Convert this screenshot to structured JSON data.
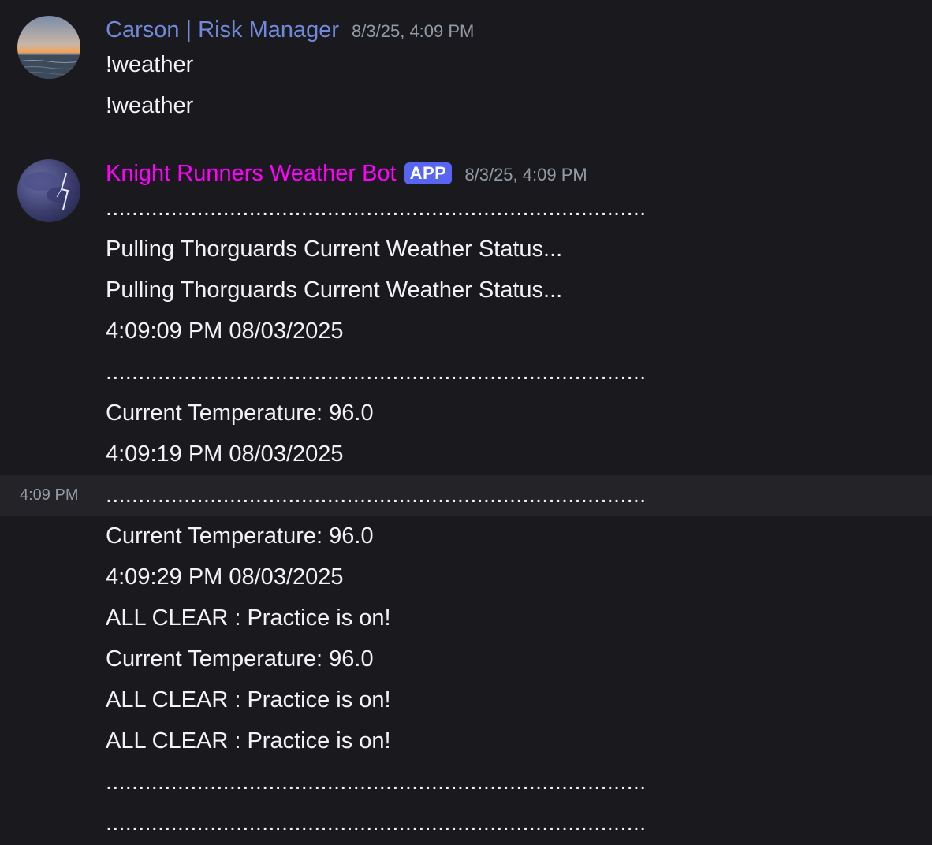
{
  "messages": [
    {
      "author": "Carson | Risk Manager",
      "author_color": "#7289da",
      "timestamp": "8/3/25, 4:09 PM",
      "lines": [
        "!weather",
        "!weather"
      ]
    },
    {
      "author": "Knight Runners Weather Bot",
      "author_color": "#ff00ff",
      "badge": "APP",
      "timestamp": "8/3/25, 4:09 PM",
      "lines": [
        "...................................................................................",
        "Pulling Thorguards Current Weather Status...",
        "Pulling Thorguards Current Weather Status...",
        "4:09:09 PM 08/03/2025",
        "...................................................................................",
        "Current Temperature: 96.0",
        "4:09:19 PM 08/03/2025",
        "...................................................................................",
        "Current Temperature: 96.0",
        "4:09:29 PM 08/03/2025",
        "ALL CLEAR : Practice is on!",
        "Current Temperature: 96.0",
        "ALL CLEAR : Practice is on!",
        "ALL CLEAR : Practice is on!",
        "...................................................................................",
        "..................................................................................."
      ]
    }
  ],
  "hover_timestamp": "4:09 PM"
}
